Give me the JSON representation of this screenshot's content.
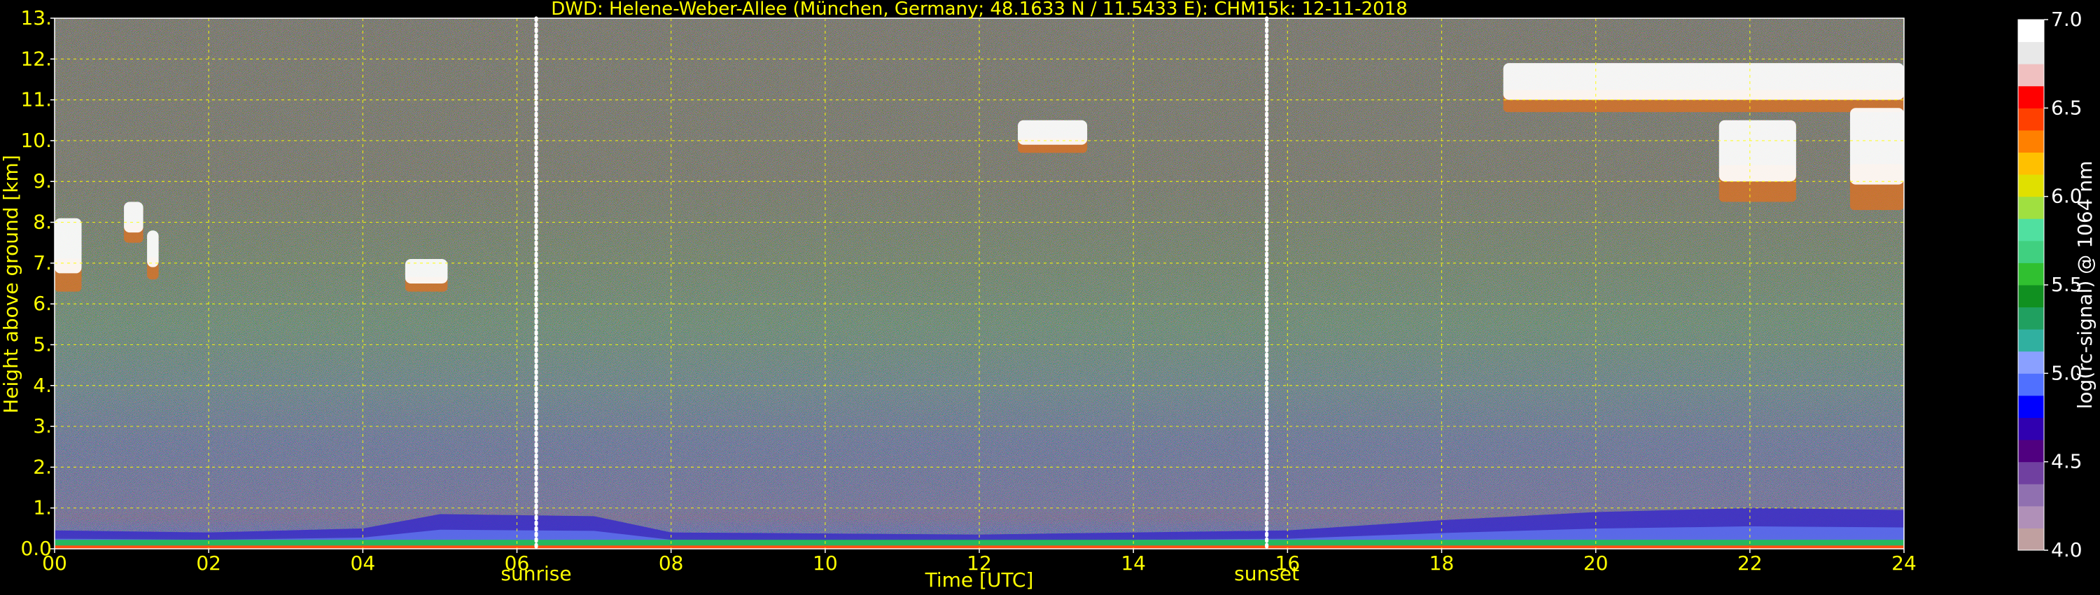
{
  "chart_data": {
    "type": "heatmap",
    "title": "DWD: Helene-Weber-Allee (München, Germany; 48.1633 N / 11.5433 E):    CHM15k: 12-11-2018",
    "xlabel": "Time [UTC]",
    "ylabel": "Height above ground [km]",
    "x_ticks": [
      "00",
      "02",
      "04",
      "06",
      "08",
      "10",
      "12",
      "14",
      "16",
      "18",
      "20",
      "22",
      "24"
    ],
    "y_ticks": [
      "0.0",
      "1.",
      "2.",
      "3.",
      "4.",
      "5.",
      "6.",
      "7.",
      "8.",
      "9.",
      "10.",
      "11.",
      "12.",
      "13."
    ],
    "xlim": [
      0,
      24
    ],
    "ylim": [
      0,
      13
    ],
    "grid": true,
    "annotations": [
      {
        "label": "sunrise",
        "x": 6.25
      },
      {
        "label": "sunset",
        "x": 15.73
      }
    ],
    "colorbar": {
      "label": "log(rc-signal) @ 1064 nm",
      "ticks": [
        "4.0",
        "4.5",
        "5.0",
        "5.5",
        "6.0",
        "6.5",
        "7.0"
      ],
      "range": [
        4.0,
        7.0
      ],
      "colors": [
        "#c0a0a0",
        "#b090b8",
        "#9070b0",
        "#7040a0",
        "#500080",
        "#3000b0",
        "#0000ff",
        "#5070ff",
        "#8aa0ff",
        "#30b0a0",
        "#20a060",
        "#109020",
        "#30c030",
        "#40d080",
        "#50e0a0",
        "#a0e040",
        "#e0e000",
        "#ffc000",
        "#ff8000",
        "#ff4000",
        "#ff0000",
        "#f0c0c0",
        "#e8e8e8",
        "#ffffff"
      ]
    },
    "cloud_layers": [
      {
        "t_start": 0.0,
        "t_end": 0.35,
        "h_bottom": 6.3,
        "h_top": 8.1
      },
      {
        "t_start": 0.9,
        "t_end": 1.15,
        "h_bottom": 7.5,
        "h_top": 8.5
      },
      {
        "t_start": 1.2,
        "t_end": 1.35,
        "h_bottom": 6.6,
        "h_top": 7.8
      },
      {
        "t_start": 4.55,
        "t_end": 5.1,
        "h_bottom": 6.3,
        "h_top": 7.1
      },
      {
        "t_start": 12.5,
        "t_end": 13.4,
        "h_bottom": 9.7,
        "h_top": 10.5
      },
      {
        "t_start": 18.8,
        "t_end": 24.0,
        "h_bottom": 10.7,
        "h_top": 11.9
      },
      {
        "t_start": 21.6,
        "t_end": 22.6,
        "h_bottom": 8.5,
        "h_top": 10.5
      },
      {
        "t_start": 23.3,
        "t_end": 24.0,
        "h_bottom": 8.3,
        "h_top": 10.8
      }
    ],
    "boundary_layer": [
      {
        "t": 0,
        "h": 0.45
      },
      {
        "t": 2,
        "h": 0.4
      },
      {
        "t": 4,
        "h": 0.5
      },
      {
        "t": 5,
        "h": 0.85
      },
      {
        "t": 7,
        "h": 0.8
      },
      {
        "t": 8,
        "h": 0.4
      },
      {
        "t": 12,
        "h": 0.35
      },
      {
        "t": 16,
        "h": 0.45
      },
      {
        "t": 18,
        "h": 0.7
      },
      {
        "t": 20,
        "h": 0.9
      },
      {
        "t": 22,
        "h": 1.0
      },
      {
        "t": 24,
        "h": 0.95
      }
    ]
  }
}
